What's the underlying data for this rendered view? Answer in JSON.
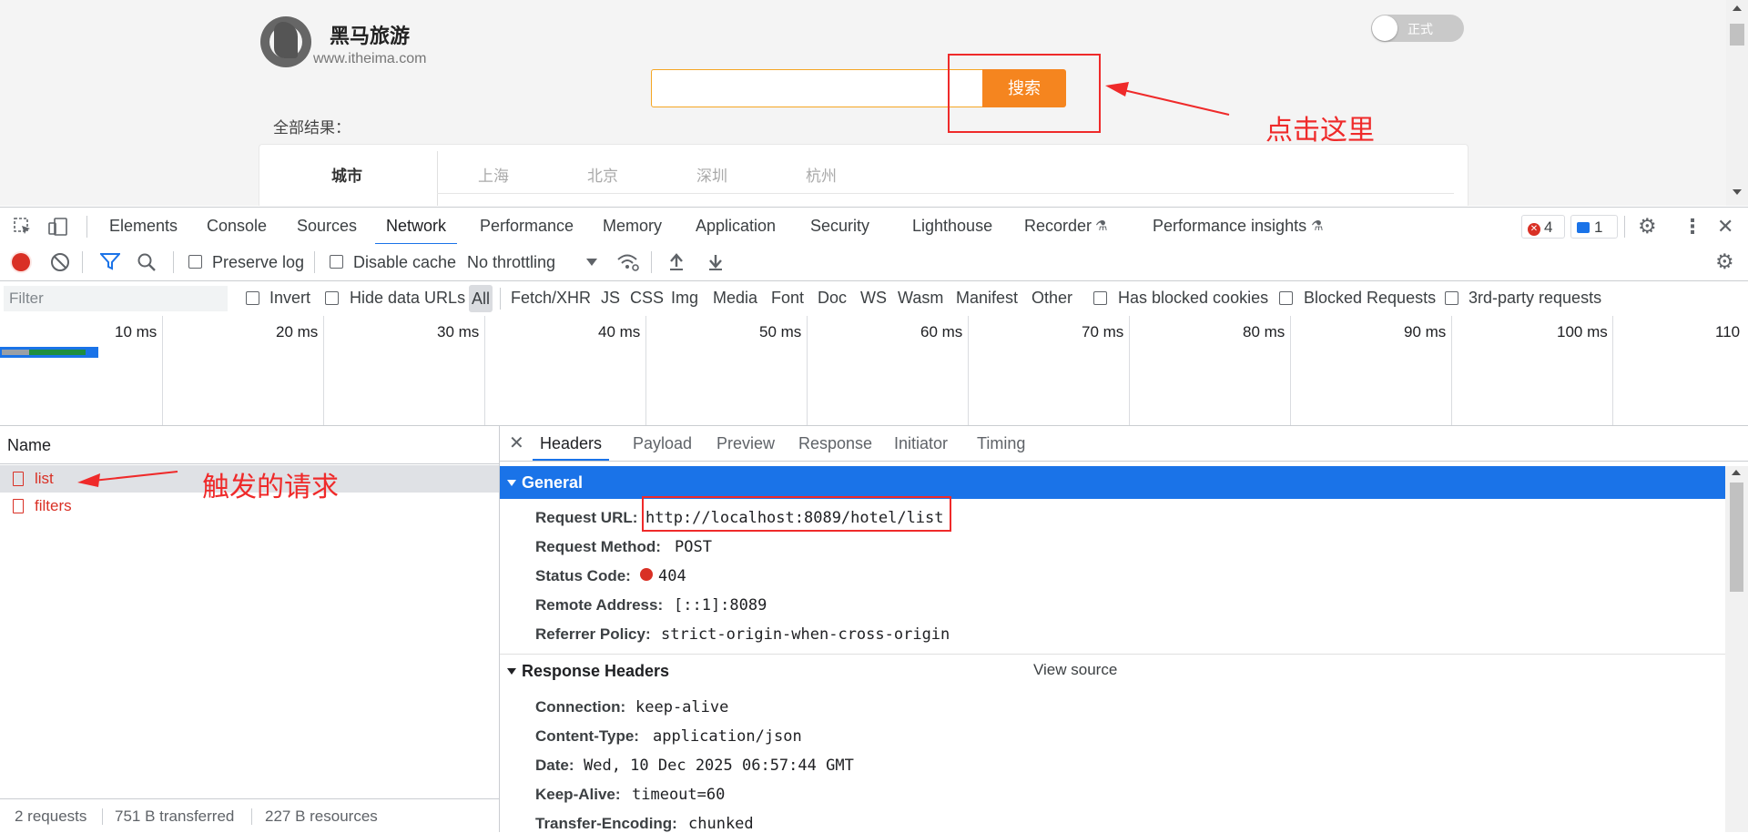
{
  "webpage": {
    "brand_name": "黑马旅游",
    "brand_url": "www.itheima.com",
    "search_button": "搜索",
    "search_value": "",
    "all_results": "全部结果：",
    "city_label": "城市",
    "cities": [
      "上海",
      "北京",
      "深圳",
      "杭州"
    ],
    "toggle_label": "正式"
  },
  "annotations": {
    "click_here": "点击这里",
    "triggered_request": "触发的请求"
  },
  "devtools": {
    "tabs": [
      "Elements",
      "Console",
      "Sources",
      "Network",
      "Performance",
      "Memory",
      "Application",
      "Security",
      "Lighthouse",
      "Recorder",
      "Performance insights"
    ],
    "active_tab": "Network",
    "error_count": "4",
    "message_count": "1",
    "toolbar": {
      "preserve_log": "Preserve log",
      "disable_cache": "Disable cache",
      "throttling": "No throttling"
    },
    "filter": {
      "placeholder": "Filter",
      "invert": "Invert",
      "hide_data_urls": "Hide data URLs",
      "types": [
        "All",
        "Fetch/XHR",
        "JS",
        "CSS",
        "Img",
        "Media",
        "Font",
        "Doc",
        "WS",
        "Wasm",
        "Manifest",
        "Other"
      ],
      "selected_type": "All",
      "has_blocked_cookies": "Has blocked cookies",
      "blocked_requests": "Blocked Requests",
      "third_party": "3rd-party requests"
    },
    "timeline_ticks": [
      "10 ms",
      "20 ms",
      "30 ms",
      "40 ms",
      "50 ms",
      "60 ms",
      "70 ms",
      "80 ms",
      "90 ms",
      "100 ms",
      "110"
    ],
    "name_header": "Name",
    "requests": [
      "list",
      "filters"
    ],
    "selected_request": "list",
    "status_bar": {
      "requests": "2 requests",
      "transferred": "751 B transferred",
      "resources": "227 B resources"
    },
    "detail_tabs": [
      "Headers",
      "Payload",
      "Preview",
      "Response",
      "Initiator",
      "Timing"
    ],
    "active_detail_tab": "Headers",
    "general": {
      "title": "General",
      "request_url_key": "Request URL:",
      "request_url": "http://localhost:8089/hotel/list",
      "request_method_key": "Request Method:",
      "request_method": "POST",
      "status_code_key": "Status Code:",
      "status_code": "404",
      "remote_address_key": "Remote Address:",
      "remote_address": "[::1]:8089",
      "referrer_policy_key": "Referrer Policy:",
      "referrer_policy": "strict-origin-when-cross-origin"
    },
    "response_headers": {
      "title": "Response Headers",
      "view_source": "View source",
      "connection_key": "Connection:",
      "connection": "keep-alive",
      "content_type_key": "Content-Type:",
      "content_type": "application/json",
      "date_key": "Date:",
      "date": "Wed, 10 Dec 2025 06:57:44 GMT",
      "keep_alive_key": "Keep-Alive:",
      "keep_alive": "timeout=60",
      "transfer_encoding_key": "Transfer-Encoding:",
      "transfer_encoding": "chunked"
    },
    "colors": {
      "accent": "#1a73e8",
      "error": "#d93025",
      "annotation": "#ef2a2a",
      "search_button": "#f5851f"
    }
  }
}
